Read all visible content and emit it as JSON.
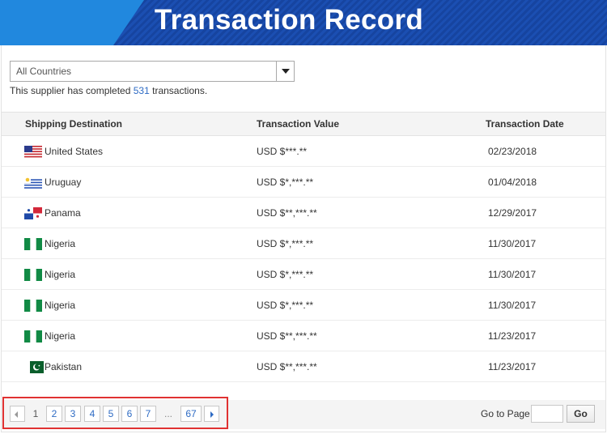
{
  "header": {
    "title": "Transaction Record"
  },
  "filter": {
    "selected": "All Countries"
  },
  "summary": {
    "prefix": "This supplier has completed ",
    "count": "531",
    "suffix": " transactions."
  },
  "table": {
    "columns": [
      "Shipping Destination",
      "Transaction Value",
      "Transaction Date"
    ],
    "rows": [
      {
        "country": "United States",
        "flag": "us-flag-icon",
        "value": "USD $***.**",
        "date": "02/23/2018"
      },
      {
        "country": "Uruguay",
        "flag": "uruguay-flag-icon",
        "value": "USD $*,***.**",
        "date": "01/04/2018"
      },
      {
        "country": "Panama",
        "flag": "panama-flag-icon",
        "value": "USD $**,***.**",
        "date": "12/29/2017"
      },
      {
        "country": "Nigeria",
        "flag": "nigeria-flag-icon",
        "value": "USD $*,***.**",
        "date": "11/30/2017"
      },
      {
        "country": "Nigeria",
        "flag": "nigeria-flag-icon",
        "value": "USD $*,***.**",
        "date": "11/30/2017"
      },
      {
        "country": "Nigeria",
        "flag": "nigeria-flag-icon",
        "value": "USD $*,***.**",
        "date": "11/30/2017"
      },
      {
        "country": "Nigeria",
        "flag": "nigeria-flag-icon",
        "value": "USD $**,***.**",
        "date": "11/23/2017"
      },
      {
        "country": "Pakistan",
        "flag": "pakistan-flag-icon",
        "value": "USD $**,***.**",
        "date": "11/23/2017"
      }
    ]
  },
  "pagination": {
    "current": "1",
    "pages": [
      "2",
      "3",
      "4",
      "5",
      "6",
      "7"
    ],
    "ellipsis": "...",
    "last": "67",
    "goto_label": "Go to Page",
    "goto_value": "",
    "go_button": "Go"
  },
  "colors": {
    "banner": "#1a4fb0",
    "link": "#2e6bc4",
    "highlight": "#e03232"
  }
}
